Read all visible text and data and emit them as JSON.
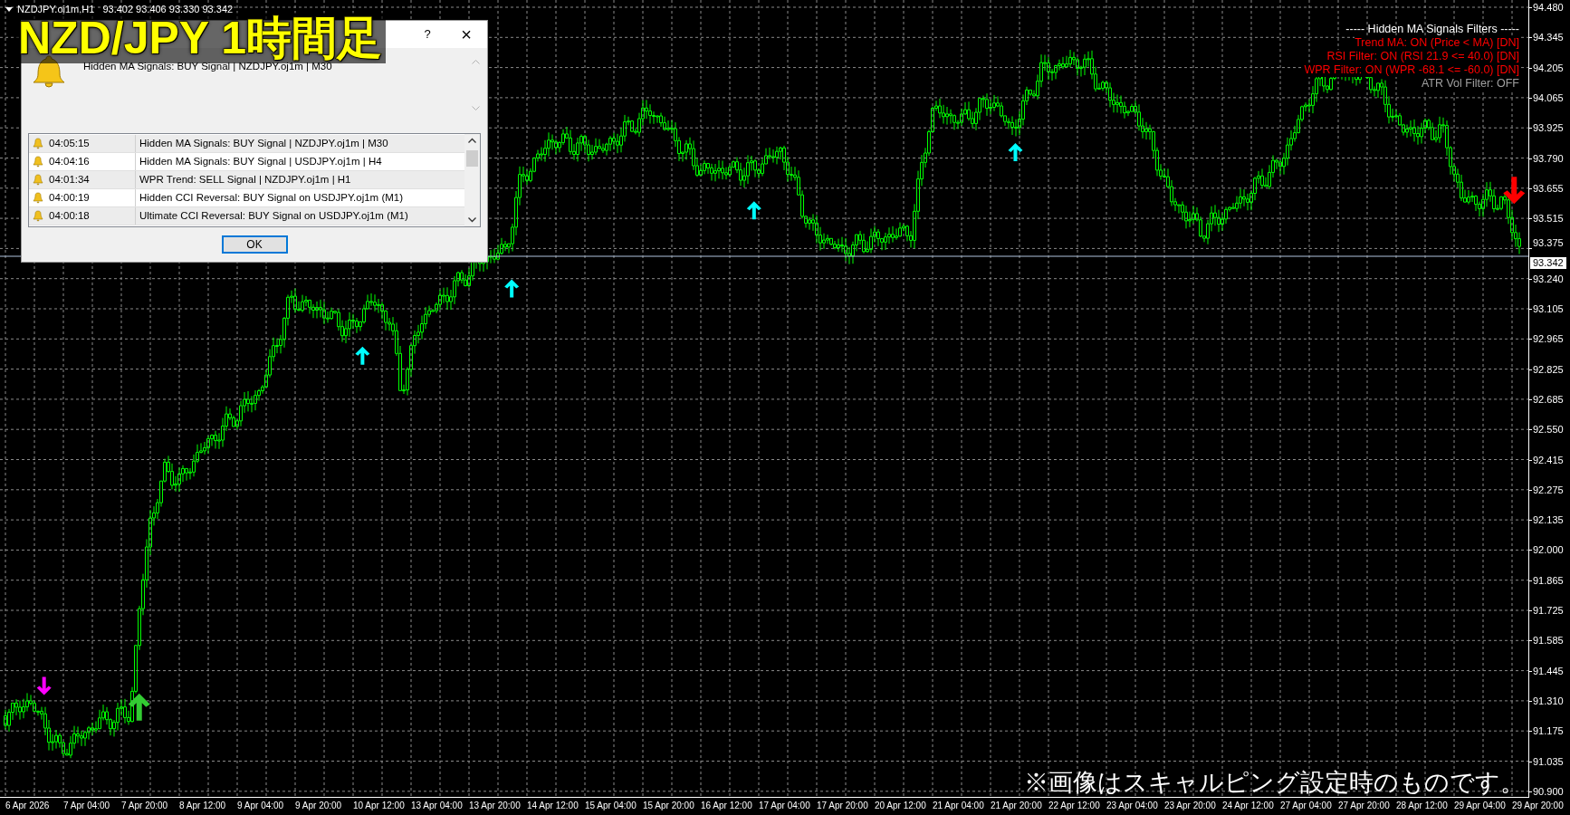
{
  "chart": {
    "header": {
      "symbol": "NZDJPY.oj1m,H1",
      "ohlc": "93.402 93.406 93.330 93.342"
    },
    "price_axis": [
      "94.480",
      "94.345",
      "94.205",
      "94.065",
      "93.925",
      "93.790",
      "93.655",
      "93.515",
      "93.375",
      "93.240",
      "93.105",
      "92.965",
      "92.825",
      "92.685",
      "92.550",
      "92.415",
      "92.275",
      "92.135",
      "92.000",
      "91.865",
      "91.725",
      "91.585",
      "91.445",
      "91.310",
      "91.175",
      "91.035",
      "90.900"
    ],
    "current_price": "93.342",
    "time_axis": [
      "6 Apr 2026",
      "7 Apr 04:00",
      "7 Apr 20:00",
      "8 Apr 12:00",
      "9 Apr 04:00",
      "9 Apr 20:00",
      "10 Apr 12:00",
      "13 Apr 04:00",
      "13 Apr 20:00",
      "14 Apr 12:00",
      "15 Apr 04:00",
      "15 Apr 20:00",
      "16 Apr 12:00",
      "17 Apr 04:00",
      "17 Apr 20:00",
      "20 Apr 12:00",
      "21 Apr 04:00",
      "21 Apr 20:00",
      "22 Apr 12:00",
      "23 Apr 04:00",
      "23 Apr 20:00",
      "24 Apr 12:00",
      "27 Apr 04:00",
      "27 Apr 20:00",
      "28 Apr 12:00",
      "29 Apr 04:00",
      "29 Apr 20:00"
    ]
  },
  "filters": {
    "title": "----- Hidden MA Signals Filters -----",
    "items": [
      {
        "text": "Trend MA: ON (Price < MA) [DN]",
        "on": true
      },
      {
        "text": "RSI Filter: ON (RSI 21.9 <= 40.0) [DN]",
        "on": true
      },
      {
        "text": "WPR Filter: ON (WPR -68.1 <= -60.0) [DN]",
        "on": true
      },
      {
        "text": "ATR Vol Filter: OFF",
        "on": false
      }
    ]
  },
  "alert_dialog": {
    "help": "?",
    "close": "×",
    "message": "Hidden MA Signals: BUY Signal | NZDJPY.oj1m | M30",
    "alerts": [
      {
        "time": "04:05:15",
        "text": "Hidden MA Signals: BUY Signal | NZDJPY.oj1m | M30"
      },
      {
        "time": "04:04:16",
        "text": "Hidden MA Signals: BUY Signal | USDJPY.oj1m | H4"
      },
      {
        "time": "04:01:34",
        "text": "WPR Trend: SELL Signal | NZDJPY.oj1m | H1"
      },
      {
        "time": "04:00:19",
        "text": "Hidden CCI Reversal: BUY Signal on USDJPY.oj1m (M1)"
      },
      {
        "time": "04:00:18",
        "text": "Ultimate CCI Reversal: BUY Signal on USDJPY.oj1m (M1)"
      }
    ],
    "ok": "OK"
  },
  "overlay": {
    "title": "NZD/JPY 1時間足",
    "note": "※画像はスキャルピング設定時のものです。"
  }
}
